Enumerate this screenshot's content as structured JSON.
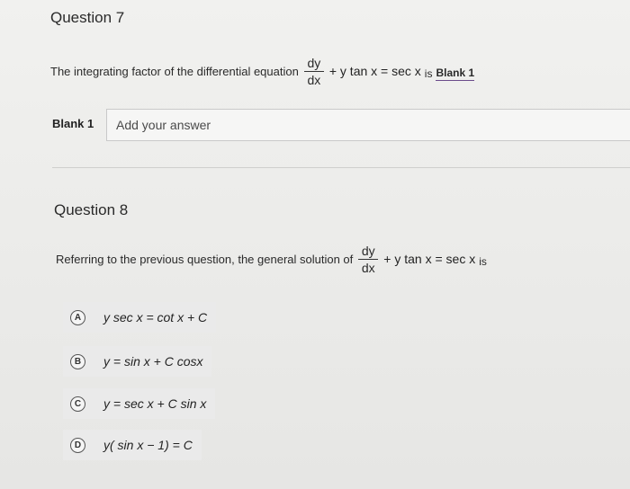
{
  "question7": {
    "title": "Question 7",
    "stem_prefix": "The integrating factor of the differential equation",
    "frac_num": "dy",
    "frac_den": "dx",
    "equation_rest": "+ y tan x  =  sec x",
    "is_word": "is",
    "blank_ref": "Blank 1",
    "blank_label": "Blank 1",
    "input_placeholder": "Add your answer",
    "input_value": ""
  },
  "question8": {
    "title": "Question 8",
    "stem_prefix": "Referring to the previous question, the general solution of",
    "frac_num": "dy",
    "frac_den": "dx",
    "equation_rest": "+ y tan x  =  sec x",
    "is_word": "is",
    "options": [
      {
        "letter": "A",
        "text": "y sec x  =  cot x  +  C"
      },
      {
        "letter": "B",
        "text": "y =  sin x  +  C cosx"
      },
      {
        "letter": "C",
        "text": "y  =  sec x  +  C sin x"
      },
      {
        "letter": "D",
        "text": "y( sin x  −  1)  =  C"
      }
    ]
  }
}
